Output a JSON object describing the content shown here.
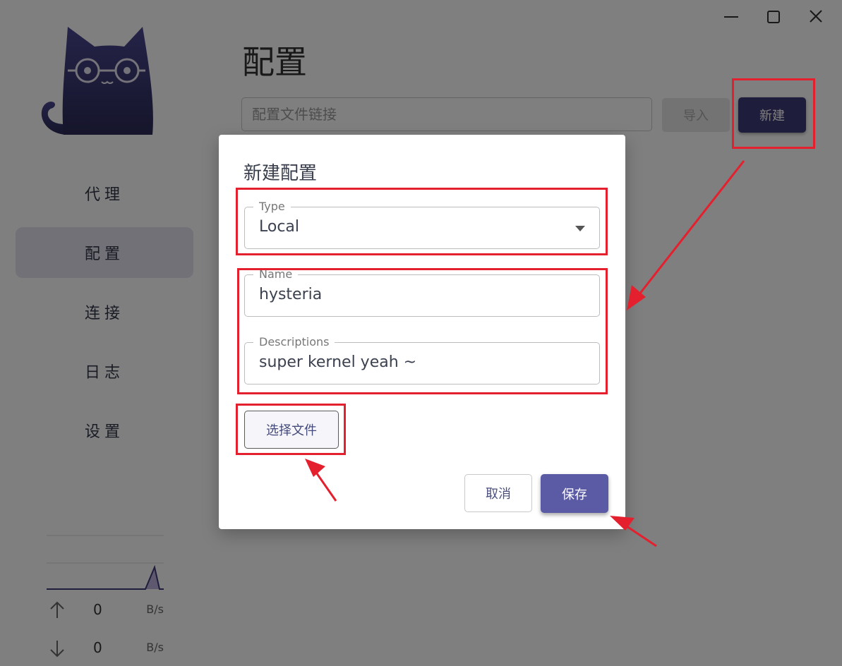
{
  "window": {
    "controls": [
      "minimize-icon",
      "maximize-icon",
      "close-icon"
    ]
  },
  "sidebar": {
    "items": [
      {
        "label": "代理"
      },
      {
        "label": "配置"
      },
      {
        "label": "连接"
      },
      {
        "label": "日志"
      },
      {
        "label": "设置"
      }
    ],
    "active_index": 1,
    "traffic": {
      "upload": {
        "value": "0",
        "unit": "B/s"
      },
      "download": {
        "value": "0",
        "unit": "B/s"
      }
    }
  },
  "main": {
    "title": "配置",
    "url_input": {
      "placeholder": "配置文件链接",
      "value": ""
    },
    "import_label": "导入",
    "new_label": "新建"
  },
  "dialog": {
    "title": "新建配置",
    "type": {
      "label": "Type",
      "value": "Local"
    },
    "name": {
      "label": "Name",
      "value": "hysteria"
    },
    "descriptions": {
      "label": "Descriptions",
      "value": "super kernel yeah ~"
    },
    "choose_file_label": "选择文件",
    "cancel_label": "取消",
    "save_label": "保存"
  },
  "colors": {
    "accent": "#3d3a78",
    "save_button": "#5b5aa4",
    "annotation": "#e5202e",
    "active_nav_bg": "#e3e2ef"
  }
}
